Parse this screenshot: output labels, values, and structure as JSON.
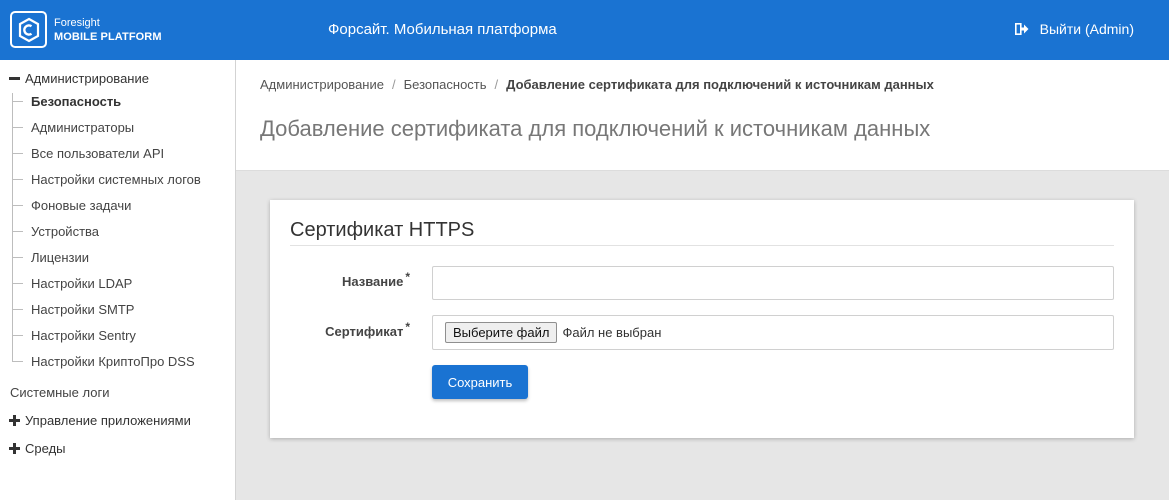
{
  "header": {
    "logo_line1": "Foresight",
    "logo_line2": "MOBILE PLATFORM",
    "app_title": "Форсайт. Мобильная платформа",
    "logout_label": "Выйти (Admin)",
    "logout_icon": "sign-out-icon",
    "brand_color": "#1a73d2"
  },
  "sidebar": {
    "admin_section": {
      "label": "Администрирование",
      "expanded": true,
      "items": [
        {
          "label": "Безопасность",
          "active": true
        },
        {
          "label": "Администраторы"
        },
        {
          "label": "Все пользователи API"
        },
        {
          "label": "Настройки системных логов"
        },
        {
          "label": "Фоновые задачи"
        },
        {
          "label": "Устройства"
        },
        {
          "label": "Лицензии"
        },
        {
          "label": "Настройки LDAP"
        },
        {
          "label": "Настройки SMTP"
        },
        {
          "label": "Настройки Sentry"
        },
        {
          "label": "Настройки КриптоПро DSS"
        }
      ]
    },
    "system_logs": "Системные логи",
    "apps_section": {
      "label": "Управление приложениями",
      "expanded": false
    },
    "envs_section": {
      "label": "Среды",
      "expanded": false
    }
  },
  "breadcrumb": {
    "items": [
      "Администрирование",
      "Безопасность"
    ],
    "separator": "/",
    "current": "Добавление сертификата для подключений к источникам данных"
  },
  "page_title": "Добавление сертификата для подключений к источникам данных",
  "form": {
    "card_title": "Сертификат HTTPS",
    "required_mark": "*",
    "name_label": "Название",
    "name_value": "",
    "cert_label": "Сертификат",
    "file_button": "Выберите файл",
    "file_status": "Файл не выбран",
    "save_label": "Сохранить"
  }
}
